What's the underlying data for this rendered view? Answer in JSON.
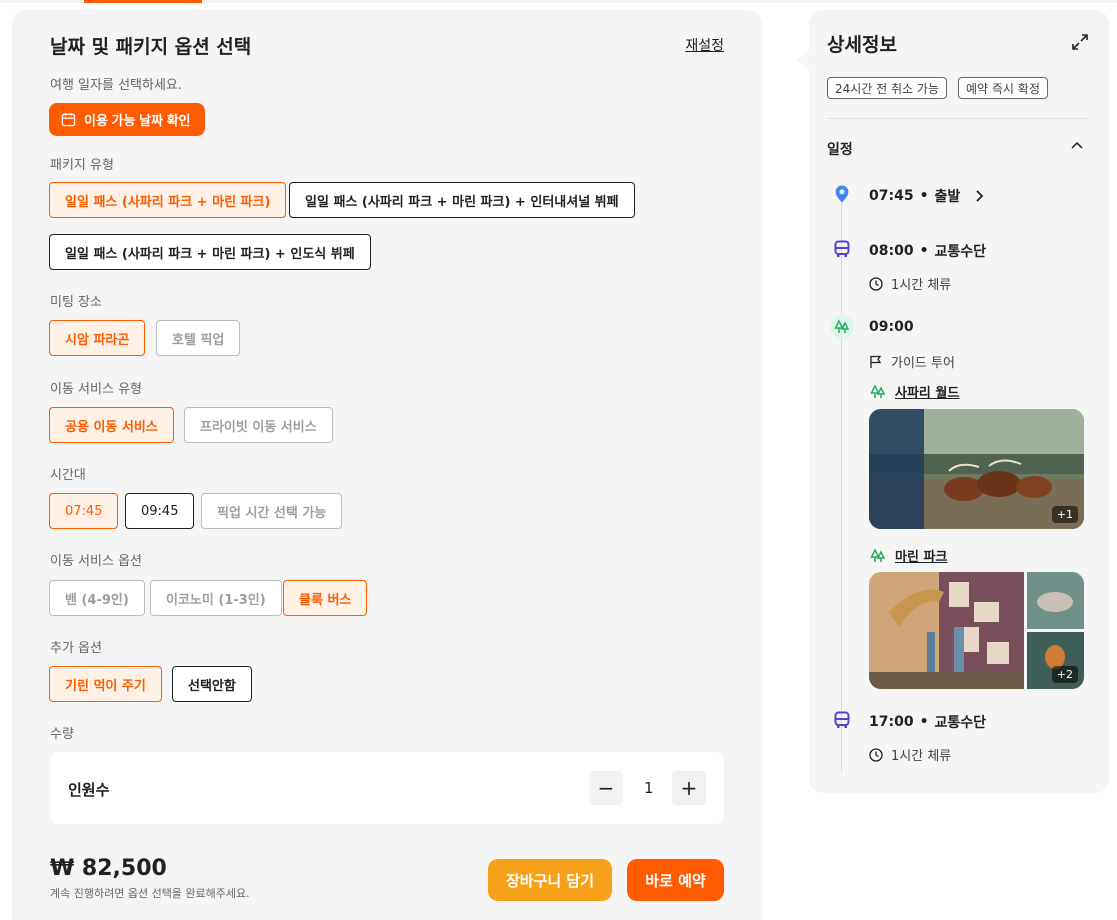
{
  "left": {
    "title": "날짜 및 패키지 옵션 선택",
    "reset_label": "재설정",
    "date": {
      "prompt": "여행 일자를 선택하세요.",
      "button_label": "이용 가능 날짜 확인"
    },
    "package": {
      "label": "패키지 유형",
      "options": [
        "일일 패스 (사파리 파크 + 마린 파크)",
        "일일 패스 (사파리 파크 + 마린 파크) + 인터내셔널 뷔페",
        "일일 패스 (사파리 파크 + 마린 파크) + 인도식 뷔페"
      ]
    },
    "meeting": {
      "label": "미팅 장소",
      "options": [
        "시암 파라곤",
        "호텔 픽업"
      ]
    },
    "transfer_type": {
      "label": "이동 서비스 유형",
      "options": [
        "공용 이동 서비스",
        "프라이빗 이동 서비스"
      ]
    },
    "time_slot": {
      "label": "시간대",
      "options": [
        "07:45",
        "09:45",
        "픽업 시간 선택 가능"
      ]
    },
    "transfer_option": {
      "label": "이동 서비스 옵션",
      "options": [
        "밴 (4-9인)",
        "이코노미 (1-3인)",
        "클룩 버스"
      ]
    },
    "extra": {
      "label": "추가 옵션",
      "options": [
        "기린 먹이 주기",
        "선택안함"
      ]
    },
    "quantity": {
      "label": "수량",
      "row_label": "인원수",
      "minus": "−",
      "value": "1",
      "plus": "+"
    },
    "price": "₩ 82,500",
    "price_note": "계속 진행하려면 옵션 선택을 완료해주세요.",
    "cart_label": "장바구니 담기",
    "book_label": "바로 예약"
  },
  "right": {
    "title": "상세정보",
    "tags": [
      "24시간 전 취소 가능",
      "예약 즉시 확정"
    ],
    "schedule_label": "일정",
    "items": [
      {
        "time": "07:45",
        "dot": "•",
        "kind": "출발",
        "icon": "location-pin-icon"
      },
      {
        "time": "08:00",
        "dot": "•",
        "kind": "교통수단",
        "icon": "bus-icon",
        "sub": "1시간 체류"
      },
      {
        "time": "09:00",
        "icon": "park-icon",
        "sub": "가이드 투어",
        "places": [
          {
            "name": "사파리 월드",
            "more": "+1"
          },
          {
            "name": "마린 파크",
            "more": "+2"
          }
        ]
      },
      {
        "time": "17:00",
        "dot": "•",
        "kind": "교통수단",
        "icon": "bus-icon",
        "sub": "1시간 체류"
      }
    ]
  },
  "colors": {
    "accent": "#ff5b00",
    "cart": "#f7a11a",
    "panel": "#f5f5f5",
    "pin": "#4285f4",
    "bus": "#5b3fd1",
    "park": "#1fae62"
  }
}
